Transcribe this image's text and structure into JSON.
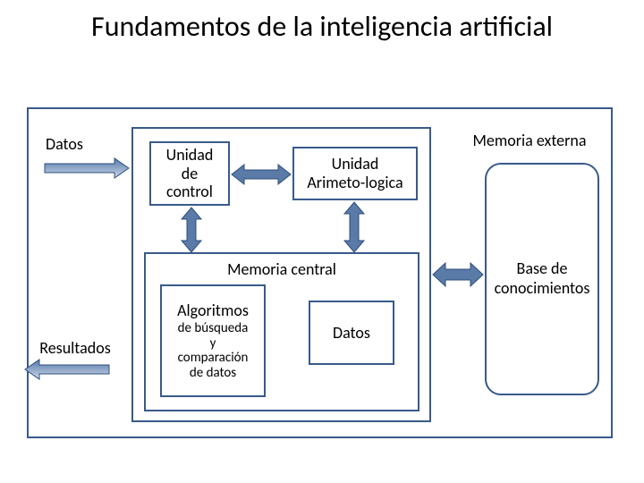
{
  "title": "Fundamentos de la inteligencia artificial",
  "labels": {
    "datos_in": "Datos",
    "resultados": "Resultados",
    "memoria_externa": "Memoria externa"
  },
  "boxes": {
    "unidad_control": "Unidad\nde\ncontrol",
    "unidad_alu": "Unidad\nArimeto-logica",
    "memoria_central": "Memoria central",
    "algoritmos_title": "Algoritmos",
    "algoritmos_sub": "de búsqueda\ny\ncomparación\nde datos",
    "datos_box": "Datos",
    "base_conocimientos": "Base  de conocimientos"
  },
  "arrows": {
    "color_blue": "#5a7aa8",
    "color_grad_a": "#5478ab",
    "color_grad_b": "#cdd8e8"
  }
}
